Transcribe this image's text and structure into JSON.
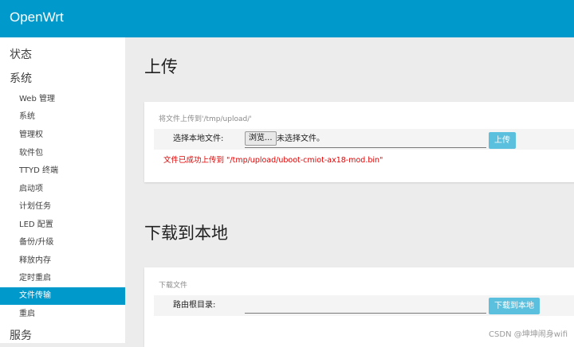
{
  "header": {
    "brand": "OpenWrt"
  },
  "sidebar": {
    "top_items": [
      "状态",
      "系统",
      "服务"
    ],
    "sub_items": [
      {
        "label": "Web 管理",
        "active": false
      },
      {
        "label": "系统",
        "active": false
      },
      {
        "label": "管理权",
        "active": false
      },
      {
        "label": "软件包",
        "active": false
      },
      {
        "label": "TTYD 终端",
        "active": false
      },
      {
        "label": "启动项",
        "active": false
      },
      {
        "label": "计划任务",
        "active": false
      },
      {
        "label": "LED 配置",
        "active": false
      },
      {
        "label": "备份/升级",
        "active": false
      },
      {
        "label": "释放内存",
        "active": false
      },
      {
        "label": "定时重启",
        "active": false
      },
      {
        "label": "文件传输",
        "active": true
      },
      {
        "label": "重启",
        "active": false
      }
    ]
  },
  "upload": {
    "title": "上传",
    "hint": "将文件上传到'/tmp/upload/'",
    "field_label": "选择本地文件:",
    "browse_label": "浏览...",
    "file_status": "未选择文件。",
    "button_label": "上传",
    "success_message": "文件已成功上传到 \"/tmp/upload/uboot-cmiot-ax18-mod.bin\""
  },
  "download": {
    "title": "下载到本地",
    "hint": "下载文件",
    "field_label": "路由根目录:",
    "path_value": "",
    "button_label": "下载到本地"
  },
  "watermark": "CSDN @坤坤闹身wifi",
  "colors": {
    "brand_blue": "#0099cc",
    "button_blue": "#5bc0de",
    "error_red": "#e00000"
  }
}
